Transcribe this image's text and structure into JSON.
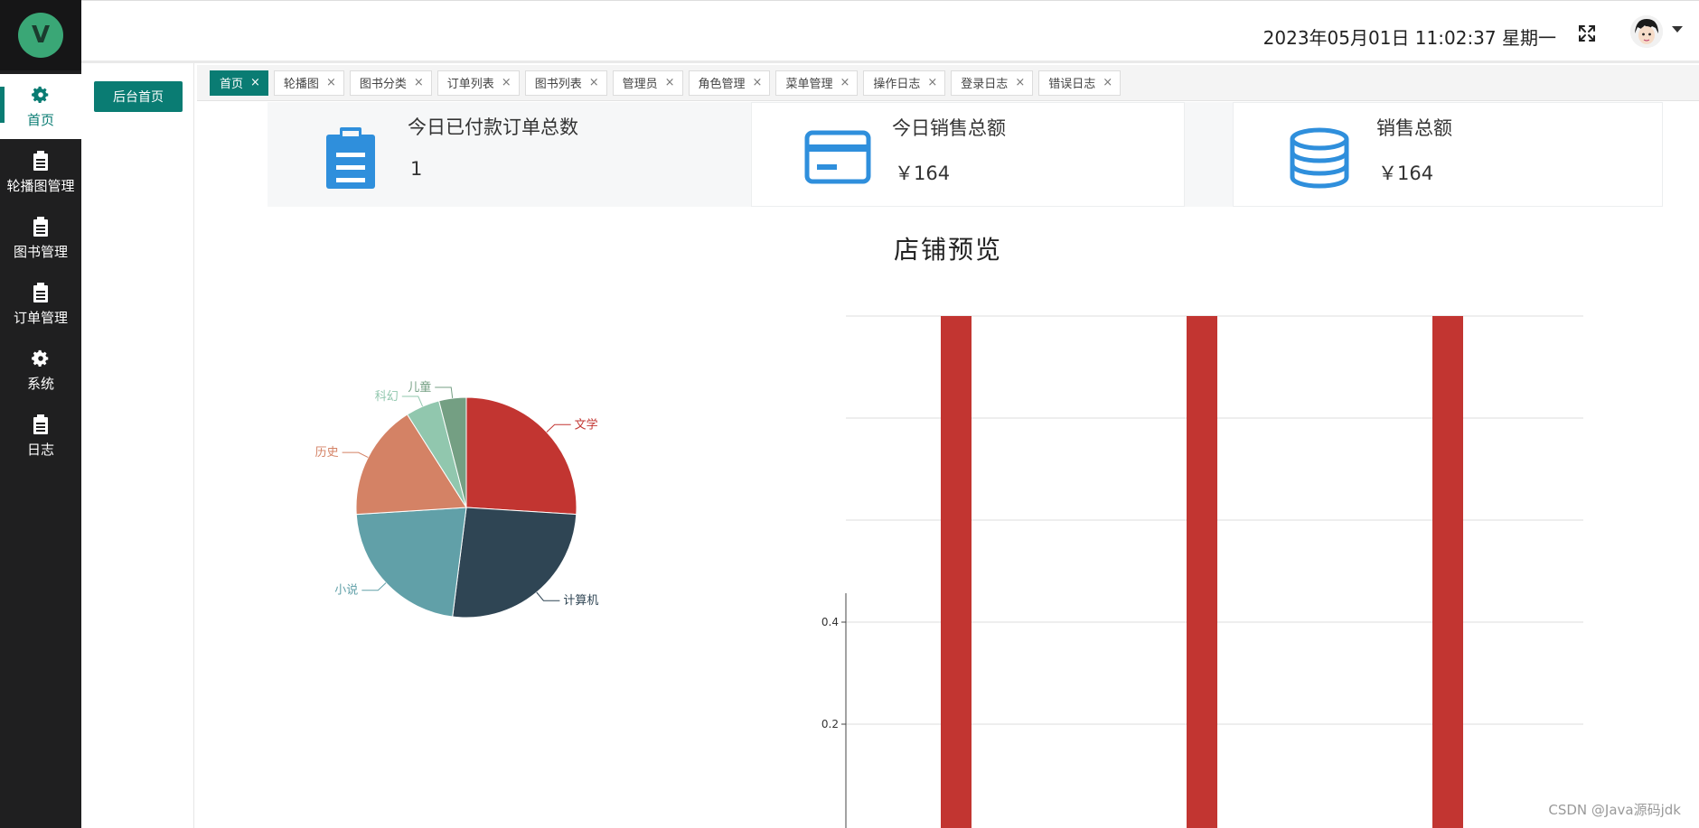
{
  "app": {
    "logo_letter": "V"
  },
  "sidebar": {
    "items": [
      {
        "label": "首页",
        "icon": "gear-icon",
        "active": true
      },
      {
        "label": "轮播图管理",
        "icon": "clipboard-icon"
      },
      {
        "label": "图书管理",
        "icon": "clipboard-icon"
      },
      {
        "label": "订单管理",
        "icon": "clipboard-icon"
      },
      {
        "label": "系统",
        "icon": "gear-icon"
      },
      {
        "label": "日志",
        "icon": "clipboard-icon"
      }
    ]
  },
  "submenu": {
    "button_label": "后台首页"
  },
  "header": {
    "datetime": "2023年05月01日 11:02:37 星期一"
  },
  "tabs": [
    {
      "label": "首页",
      "active": true
    },
    {
      "label": "轮播图"
    },
    {
      "label": "图书分类"
    },
    {
      "label": "订单列表"
    },
    {
      "label": "图书列表"
    },
    {
      "label": "管理员"
    },
    {
      "label": "角色管理"
    },
    {
      "label": "菜单管理"
    },
    {
      "label": "操作日志"
    },
    {
      "label": "登录日志"
    },
    {
      "label": "错误日志"
    }
  ],
  "tab_close_glyph": "×",
  "cards": [
    {
      "title": "今日已付款订单总数",
      "value": "1",
      "icon": "clipboard-icon"
    },
    {
      "title": "今日销售总额",
      "value": "￥164",
      "icon": "credit-card-icon"
    },
    {
      "title": "销售总额",
      "value": "￥164",
      "icon": "database-icon"
    }
  ],
  "overview_title": "店铺预览",
  "colors": {
    "accent": "#0a7c73",
    "icon_blue": "#2f8fdc",
    "bar_red": "#c23531"
  },
  "watermark": "CSDN @Java源码jdk",
  "chart_data": [
    {
      "type": "pie",
      "slices": [
        {
          "name": "文学",
          "value": 26,
          "color": "#c23531"
        },
        {
          "name": "计算机",
          "value": 26,
          "color": "#2f4554"
        },
        {
          "name": "小说",
          "value": 22,
          "color": "#61a0a8"
        },
        {
          "name": "历史",
          "value": 17,
          "color": "#d48265"
        },
        {
          "name": "科幻",
          "value": 5,
          "color": "#91c7ae"
        },
        {
          "name": "儿童",
          "value": 4,
          "color": "#749f83"
        }
      ]
    },
    {
      "type": "bar",
      "categories": [
        "",
        "",
        ""
      ],
      "values": [
        1,
        1,
        1
      ],
      "y_ticks": [
        "0.2",
        "0.4"
      ],
      "color": "#c23531",
      "grid": true
    }
  ]
}
